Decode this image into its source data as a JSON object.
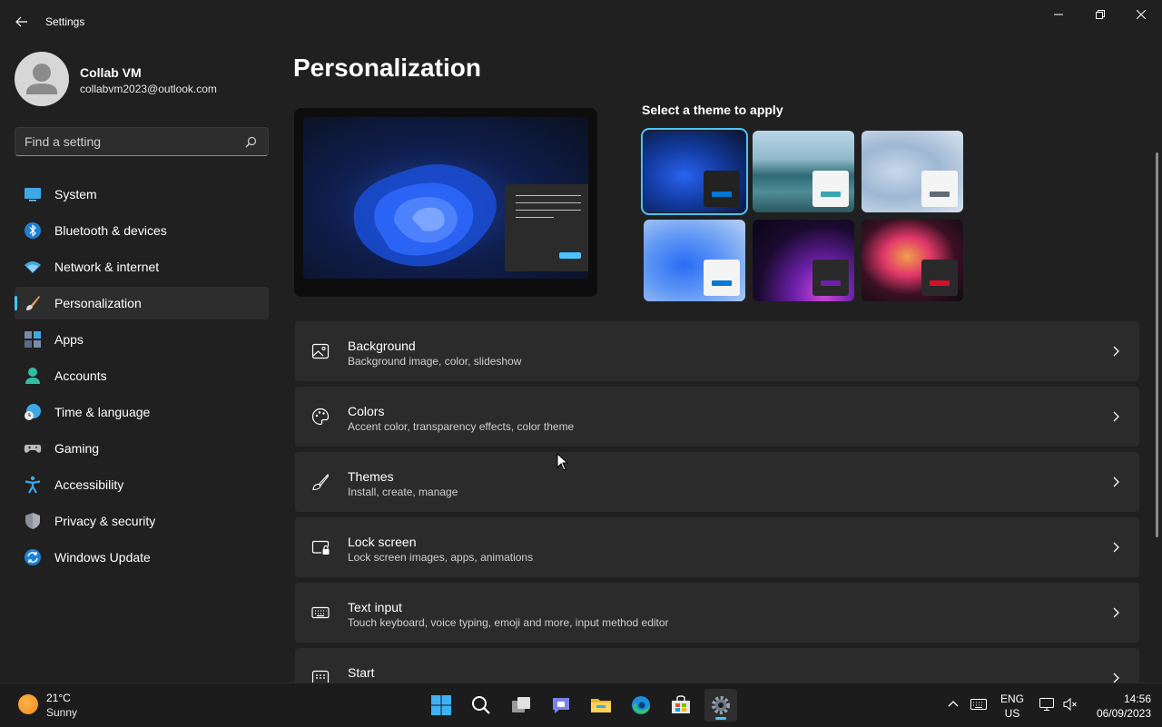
{
  "window": {
    "title": "Settings"
  },
  "user": {
    "name": "Collab VM",
    "email": "collabvm2023@outlook.com"
  },
  "search": {
    "placeholder": "Find a setting"
  },
  "sidebar": {
    "items": [
      {
        "label": "System",
        "icon": "system-icon",
        "active": false
      },
      {
        "label": "Bluetooth & devices",
        "icon": "bluetooth-icon",
        "active": false
      },
      {
        "label": "Network & internet",
        "icon": "wifi-icon",
        "active": false
      },
      {
        "label": "Personalization",
        "icon": "brush-icon",
        "active": true
      },
      {
        "label": "Apps",
        "icon": "apps-icon",
        "active": false
      },
      {
        "label": "Accounts",
        "icon": "accounts-icon",
        "active": false
      },
      {
        "label": "Time & language",
        "icon": "clock-globe-icon",
        "active": false
      },
      {
        "label": "Gaming",
        "icon": "gamepad-icon",
        "active": false
      },
      {
        "label": "Accessibility",
        "icon": "accessibility-icon",
        "active": false
      },
      {
        "label": "Privacy & security",
        "icon": "shield-icon",
        "active": false
      },
      {
        "label": "Windows Update",
        "icon": "update-icon",
        "active": false
      }
    ]
  },
  "main": {
    "title": "Personalization",
    "theme_heading": "Select a theme to apply",
    "themes": [
      {
        "name": "windows-dark-bloom",
        "selected": true,
        "accent": "#0078d4"
      },
      {
        "name": "lake",
        "selected": false,
        "accent": "#3aa6b0"
      },
      {
        "name": "light-flow",
        "selected": false,
        "accent": "#5f6b75"
      },
      {
        "name": "windows-light-bloom",
        "selected": false,
        "accent": "#0078d4"
      },
      {
        "name": "glow",
        "selected": false,
        "accent": "#6b1fa8"
      },
      {
        "name": "captured-motion",
        "selected": false,
        "accent": "#d1102a"
      }
    ],
    "cards": [
      {
        "title": "Background",
        "subtitle": "Background image, color, slideshow",
        "icon": "image-icon"
      },
      {
        "title": "Colors",
        "subtitle": "Accent color, transparency effects, color theme",
        "icon": "palette-icon"
      },
      {
        "title": "Themes",
        "subtitle": "Install, create, manage",
        "icon": "brush-icon"
      },
      {
        "title": "Lock screen",
        "subtitle": "Lock screen images, apps, animations",
        "icon": "lock-screen-icon"
      },
      {
        "title": "Text input",
        "subtitle": "Touch keyboard, voice typing, emoji and more, input method editor",
        "icon": "keyboard-icon"
      },
      {
        "title": "Start",
        "subtitle": "",
        "icon": "start-icon"
      }
    ]
  },
  "taskbar": {
    "weather": {
      "temp": "21°C",
      "desc": "Sunny"
    },
    "apps": [
      "start-icon",
      "search-icon",
      "task-view-icon",
      "teams-chat-icon",
      "file-explorer-icon",
      "edge-icon",
      "store-icon",
      "settings-icon"
    ],
    "language": {
      "line1": "ENG",
      "line2": "US"
    },
    "time": "14:56",
    "date": "06/09/2023"
  },
  "colors": {
    "accent": "#4cc2ff",
    "background": "#202020",
    "card": "#2b2b2b"
  }
}
